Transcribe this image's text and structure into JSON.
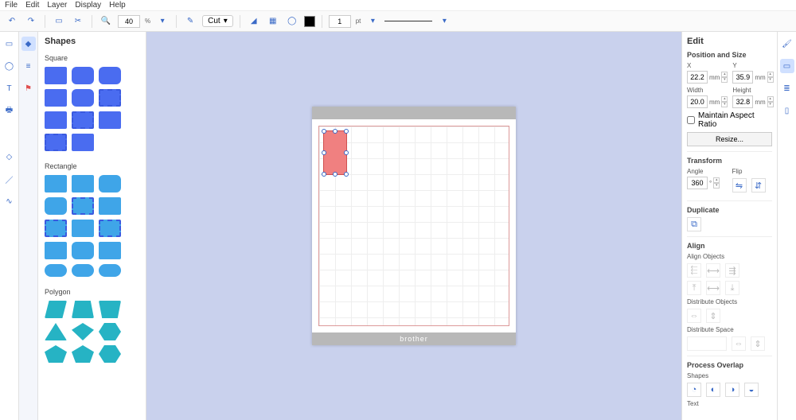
{
  "menu": {
    "file": "File",
    "edit": "Edit",
    "layer": "Layer",
    "display": "Display",
    "help": "Help"
  },
  "toolbar": {
    "zoom": "40",
    "zoom_unit": "%",
    "cut": "Cut",
    "stroke": "1",
    "stroke_unit": "pt"
  },
  "shapes": {
    "title": "Shapes",
    "cat1": "Square",
    "cat2": "Rectangle",
    "cat3": "Polygon"
  },
  "canvas": {
    "brand": "brother"
  },
  "edit": {
    "title": "Edit",
    "pos_size": "Position and Size",
    "x": "X",
    "y": "Y",
    "w": "Width",
    "h": "Height",
    "xv": "22.2",
    "yv": "35.9",
    "wv": "20.0",
    "hv": "32.8",
    "mm": "mm",
    "aspect": "Maintain Aspect Ratio",
    "resize": "Resize...",
    "transform": "Transform",
    "angle": "Angle",
    "flip": "Flip",
    "anglev": "360",
    "deg": "°",
    "duplicate": "Duplicate",
    "align": "Align",
    "align_obj": "Align Objects",
    "dist_obj": "Distribute Objects",
    "dist_space": "Distribute Space",
    "overlap": "Process Overlap",
    "shapes": "Shapes",
    "text": "Text"
  }
}
